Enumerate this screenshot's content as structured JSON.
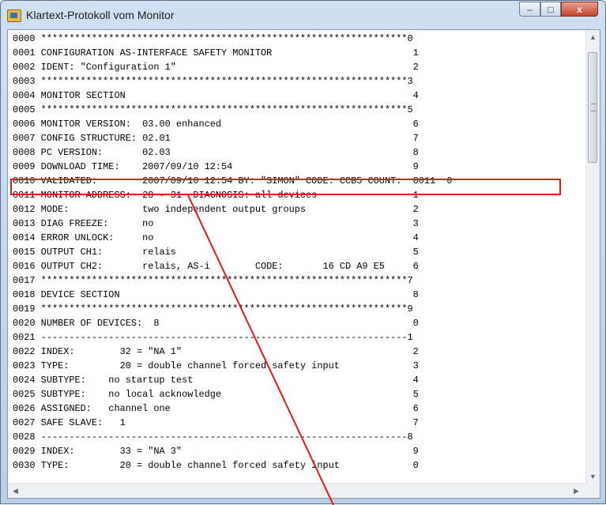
{
  "window": {
    "title": "Klartext-Protokoll vom Monitor",
    "buttons": {
      "minimize": "–",
      "maximize": "□",
      "close": "x"
    }
  },
  "icons": [
    "app-icon",
    "minimize-icon",
    "maximize-icon",
    "close-icon",
    "scroll-up-icon",
    "scroll-down-icon",
    "scroll-left-icon",
    "scroll-right-icon"
  ],
  "colors": {
    "highlight": "#e0191b",
    "title_bar": "#b9cfe8"
  },
  "lines": [
    "0000 *****************************************************************0",
    "0001 CONFIGURATION AS-INTERFACE SAFETY MONITOR                         1",
    "0002 IDENT: \"Configuration 1\"                                          2",
    "0003 *****************************************************************3",
    "0004 MONITOR SECTION                                                   4",
    "0005 *****************************************************************5",
    "0006 MONITOR VERSION:  03.00 enhanced                                  6",
    "0007 CONFIG STRUCTURE: 02.01                                           7",
    "0008 PC VERSION:       02.03                                           8",
    "0009 DOWNLOAD TIME:    2007/09/10 12:54                                9",
    "0010 VALIDATED:        2007/09/10 12:54 BY: \"SIMON\" CODE: CCB5 COUNT:  0011  0",
    "0011 MONITOR ADDRESS:  28 - 31  DIAGNOSIS: all devices                 1",
    "0012 MODE:             two independent output groups                   2",
    "0013 DIAG FREEZE:      no                                              3",
    "0014 ERROR UNLOCK:     no                                              4",
    "0015 OUTPUT CH1:       relais                                          5",
    "0016 OUTPUT CH2:       relais, AS-i        CODE:       16 CD A9 E5     6",
    "0017 *****************************************************************7",
    "0018 DEVICE SECTION                                                    8",
    "0019 *****************************************************************9",
    "0020 NUMBER OF DEVICES:  8                                             0",
    "0021 -----------------------------------------------------------------1",
    "0022 INDEX:        32 = \"NA 1\"                                         2",
    "0023 TYPE:         20 = double channel forced safety input             3",
    "0024 SUBTYPE:    no startup test                                       4",
    "0025 SUBTYPE:    no local acknowledge                                  5",
    "0026 ASSIGNED:   channel one                                           6",
    "0027 SAFE SLAVE:   1                                                   7",
    "0028 -----------------------------------------------------------------8",
    "0029 INDEX:        33 = \"NA 3\"                                         9",
    "0030 TYPE:         20 = double channel forced safety input             0"
  ]
}
